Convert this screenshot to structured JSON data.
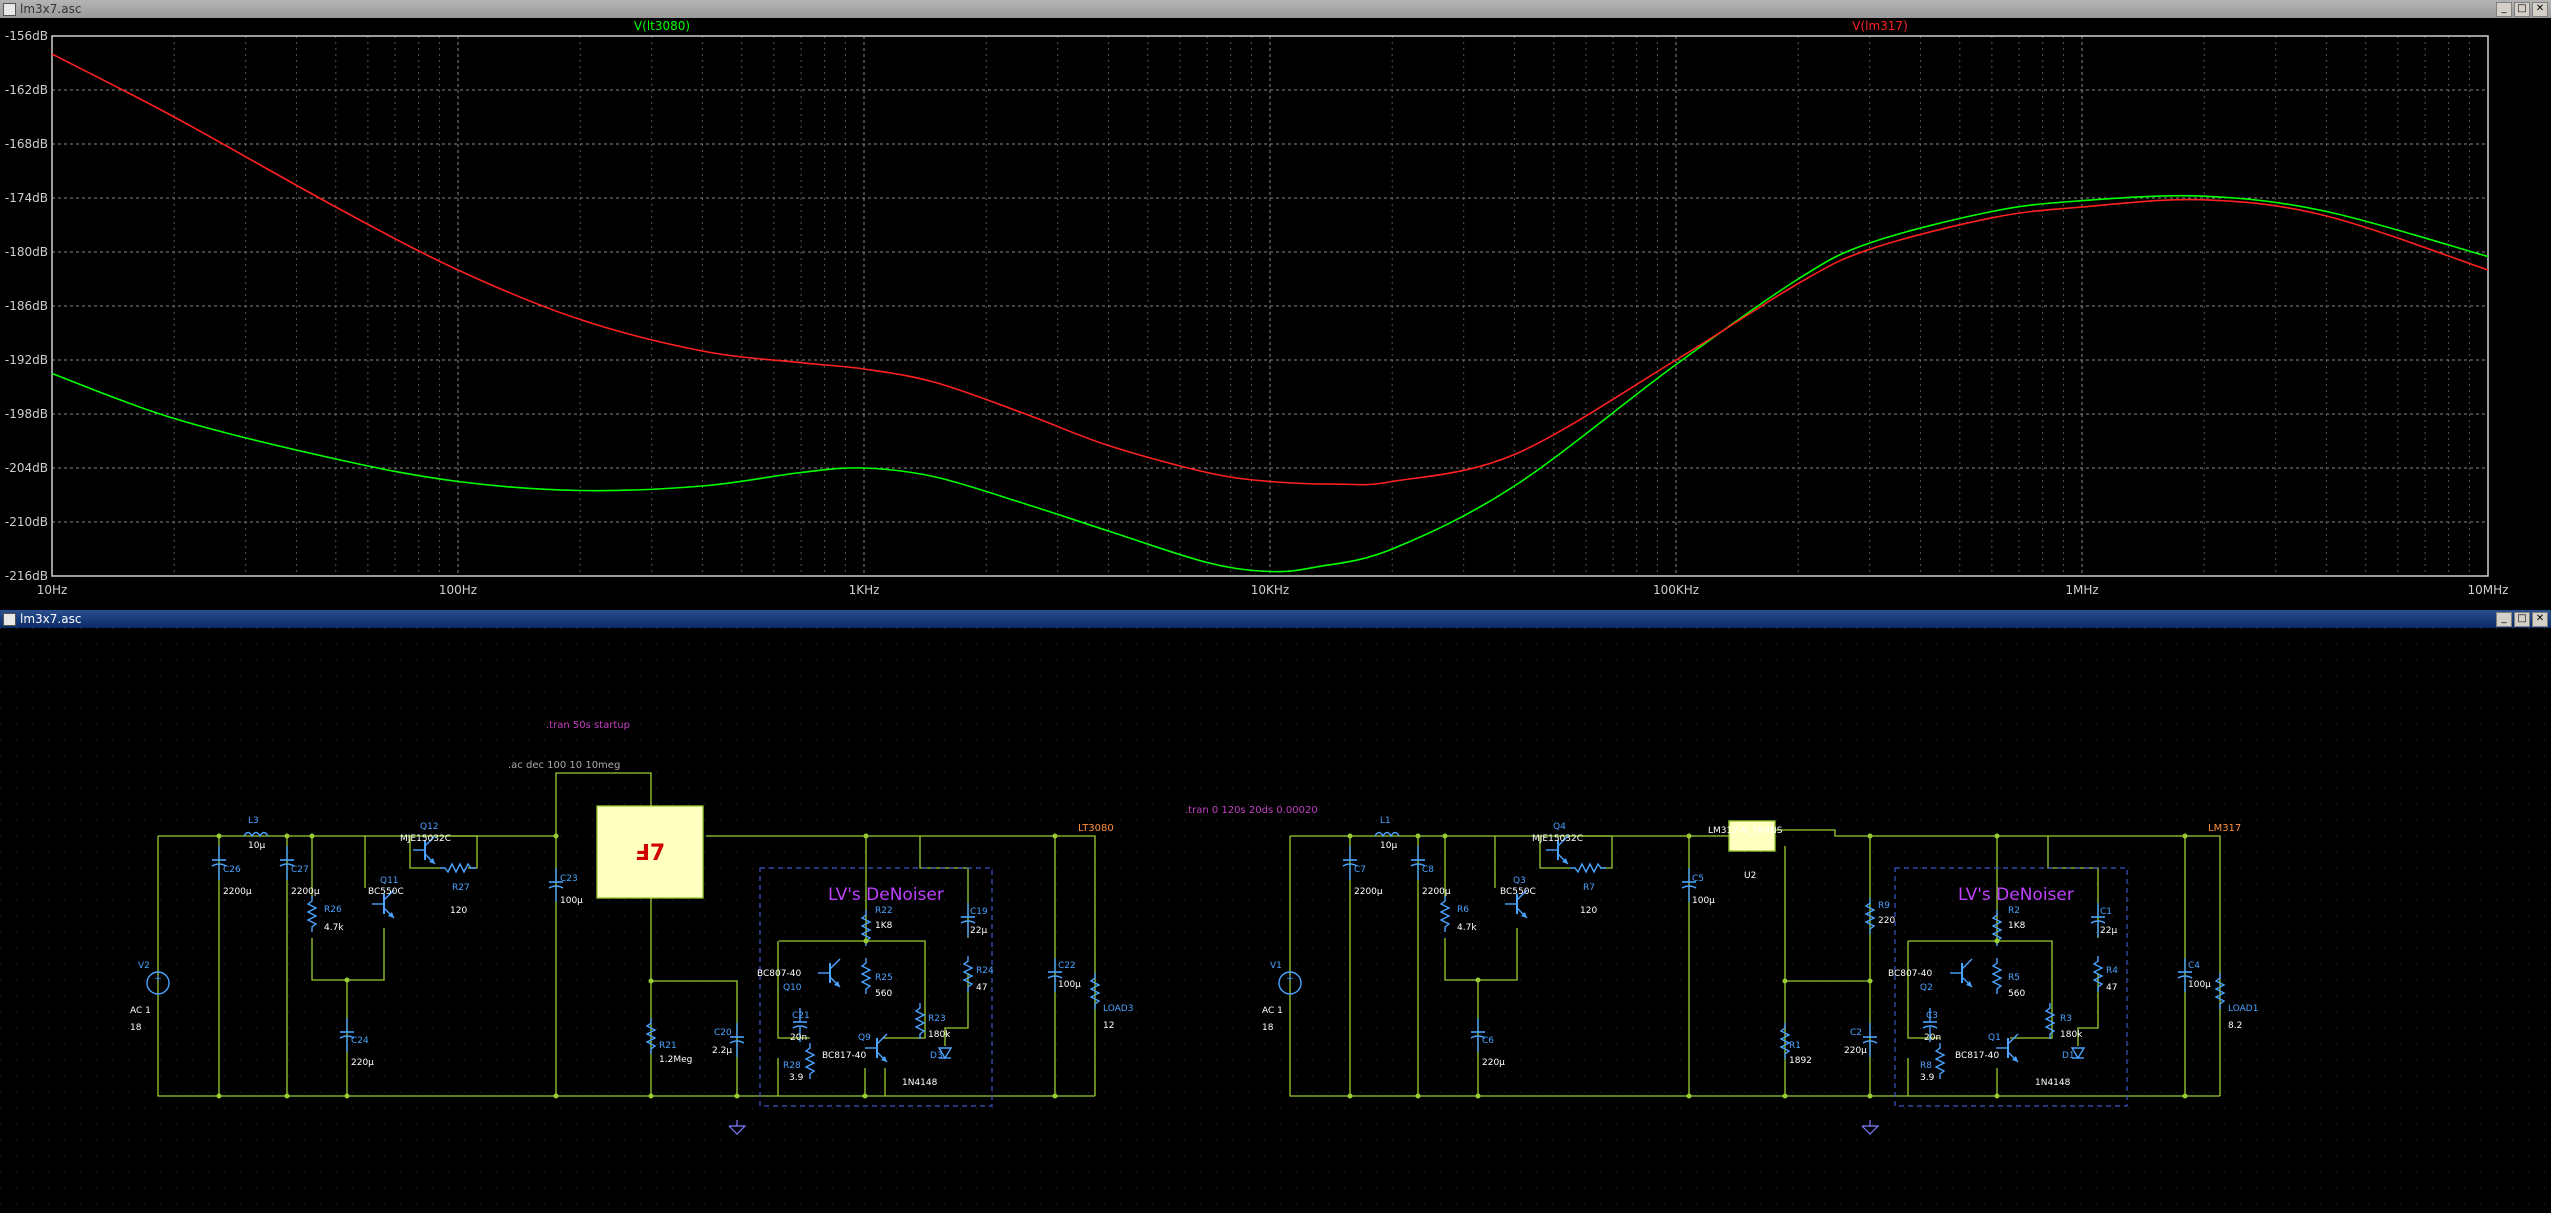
{
  "plot_window": {
    "title": "lm3x7.asc",
    "buttons": [
      "_",
      "□",
      "✕"
    ],
    "plot": {
      "traces": [
        {
          "name": "V(lt3080)",
          "color": "#00ff00"
        },
        {
          "name": "V(lm317)",
          "color": "#ff2020"
        }
      ]
    }
  },
  "schematic_window": {
    "title": "lm3x7.asc",
    "buttons": [
      "_",
      "□",
      "✕"
    ],
    "directives": {
      "tran_startup": ".tran 50s startup",
      "ac_dec": ".ac dec 100 10 10meg",
      "tran_long": ".tran 0 120s 20ds 0.00020"
    },
    "left": {
      "net_label": "LT3080",
      "block_title": "LV's DeNoiser",
      "parts": {
        "L3": "L3",
        "L3v": "10µ",
        "C26": "C26",
        "C26v": "2200µ",
        "C27": "C27",
        "C27v": "2200µ",
        "R26": "R26",
        "R26v": "4.7k",
        "Q12": "Q12",
        "Q12v": "MJE15032C",
        "Q11": "Q11",
        "Q11v": "BC550C",
        "R27": "R27",
        "R27v": "120",
        "C24": "C24",
        "C24v": "220µ",
        "C23": "C23",
        "C23v": "100µ",
        "V2": "V2",
        "V2ac": "AC 1",
        "V2v": "18",
        "R21": "R21",
        "R21v": "1.2Meg",
        "C20": "C20",
        "C20v": "2.2µ",
        "R22": "R22",
        "R22v": "1K8",
        "R25": "R25",
        "R25v": "560",
        "C19": "C19",
        "C19v": "22µ",
        "R24": "R24",
        "R24v": "47",
        "Q10n": "BC807-40",
        "Q10": "Q10",
        "C21": "C21",
        "C21v": "20n",
        "R23": "R23",
        "R23v": "180k",
        "Q9": "Q9",
        "Q9v": "BC817-40",
        "R28": "R28",
        "R28v": "3.9",
        "D3": "D3",
        "D3v": "1N4148",
        "C22": "C22",
        "C22v": "100µ",
        "LOAD3": "LOAD3",
        "LOAD3v": "12"
      }
    },
    "right": {
      "net_label": "LM317",
      "block_title": "LV's DeNoiser",
      "reg_label": "LM317-N_TRANS",
      "reg_ref": "U2",
      "parts": {
        "L1": "L1",
        "L1v": "10µ",
        "C7": "C7",
        "C7v": "2200µ",
        "C8": "C8",
        "C8v": "2200µ",
        "R6": "R6",
        "R6v": "4.7k",
        "Q4": "Q4",
        "Q4v": "MJE15032C",
        "Q3": "Q3",
        "Q3v": "BC550C",
        "R7": "R7",
        "R7v": "120",
        "C6": "C6",
        "C6v": "220µ",
        "C5": "C5",
        "C5v": "100µ",
        "V1": "V1",
        "V1ac": "AC 1",
        "V1v": "18",
        "R9": "R9",
        "R9v": "220",
        "R1": "R1",
        "R1v": "1892",
        "C2": "C2",
        "C2v": "220µ",
        "R2": "R2",
        "R2v": "1K8",
        "R5": "R5",
        "R5v": "560",
        "C1": "C1",
        "C1v": "22µ",
        "R4": "R4",
        "R4v": "47",
        "Q2n": "BC807-40",
        "Q2": "Q2",
        "C3": "C3",
        "C3v": "20n",
        "R3": "R3",
        "R3v": "180k",
        "Q1": "Q1",
        "Q1v": "BC817-40",
        "R8": "R8",
        "R8v": "3.9",
        "D1": "D1",
        "D1v": "1N4148",
        "C4": "C4",
        "C4v": "100µ",
        "LOAD1": "LOAD1",
        "LOAD1v": "8.2"
      }
    }
  },
  "chart_data": {
    "type": "line",
    "x_scale": "log",
    "xlim": [
      10,
      10000000
    ],
    "ylim": [
      -216,
      -156
    ],
    "x_ticks": [
      {
        "value": 10,
        "label": "10Hz"
      },
      {
        "value": 100,
        "label": "100Hz"
      },
      {
        "value": 1000,
        "label": "1KHz"
      },
      {
        "value": 10000,
        "label": "10KHz"
      },
      {
        "value": 100000,
        "label": "100KHz"
      },
      {
        "value": 1000000,
        "label": "1MHz"
      },
      {
        "value": 10000000,
        "label": "10MHz"
      }
    ],
    "y_ticks": [
      {
        "value": -156,
        "label": "-156dB"
      },
      {
        "value": -162,
        "label": "-162dB"
      },
      {
        "value": -168,
        "label": "-168dB"
      },
      {
        "value": -174,
        "label": "-174dB"
      },
      {
        "value": -180,
        "label": "-180dB"
      },
      {
        "value": -186,
        "label": "-186dB"
      },
      {
        "value": -192,
        "label": "-192dB"
      },
      {
        "value": -198,
        "label": "-198dB"
      },
      {
        "value": -204,
        "label": "-204dB"
      },
      {
        "value": -210,
        "label": "-210dB"
      },
      {
        "value": -216,
        "label": "-216dB"
      }
    ],
    "grid": true,
    "series": [
      {
        "name": "V(lt3080)",
        "color": "#00ff00",
        "x": [
          10,
          20,
          50,
          100,
          200,
          400,
          700,
          1000,
          1500,
          2500,
          4000,
          7000,
          10000,
          13000,
          20000,
          40000,
          100000,
          200000,
          300000,
          600000,
          1000000,
          2000000,
          4000000,
          10000000
        ],
        "y": [
          -193.5,
          -198.5,
          -203,
          -205.5,
          -206.5,
          -206,
          -204.5,
          -204,
          -205,
          -208,
          -211,
          -214.5,
          -215.5,
          -215,
          -213,
          -206,
          -192.5,
          -183,
          -179,
          -175.5,
          -174.3,
          -173.8,
          -175.5,
          -180.5
        ]
      },
      {
        "name": "V(lm317)",
        "color": "#ff2020",
        "x": [
          10,
          20,
          50,
          100,
          200,
          400,
          700,
          1000,
          1500,
          2500,
          4000,
          7000,
          10000,
          15000,
          20000,
          40000,
          100000,
          200000,
          300000,
          600000,
          1000000,
          2000000,
          4000000,
          10000000
        ],
        "y": [
          -158,
          -165,
          -175,
          -182,
          -187.5,
          -191,
          -192.3,
          -193,
          -194.5,
          -198,
          -201.5,
          -204.5,
          -205.5,
          -205.8,
          -205.5,
          -202.5,
          -192,
          -183.5,
          -179.7,
          -176.2,
          -175,
          -174.2,
          -176,
          -182
        ]
      }
    ]
  }
}
